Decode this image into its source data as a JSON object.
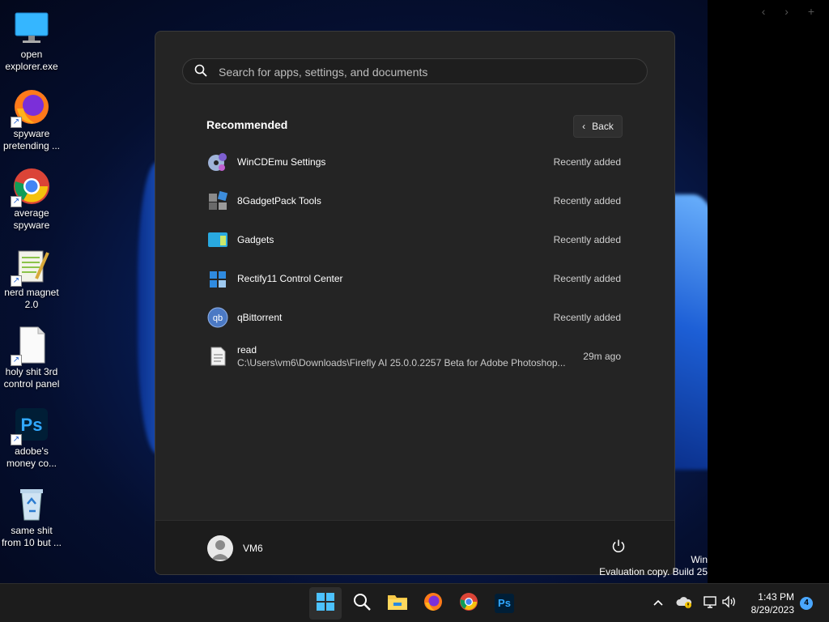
{
  "desktop": {
    "icons": [
      {
        "label": "open explorer.exe",
        "icon": "monitor-icon"
      },
      {
        "label": "spyware pretending ...",
        "icon": "firefox-icon"
      },
      {
        "label": "average spyware",
        "icon": "chrome-icon"
      },
      {
        "label": "nerd magnet 2.0",
        "icon": "notepad-plus-plus-icon"
      },
      {
        "label": "holy shit 3rd control panel",
        "icon": "blank-file-icon"
      },
      {
        "label": "adobe's money co...",
        "icon": "photoshop-icon"
      },
      {
        "label": "same shit from 10 but ...",
        "icon": "recycle-bin-icon"
      }
    ],
    "watermark_line1": "Win",
    "watermark_line2": "Evaluation copy. Build 25"
  },
  "start_menu": {
    "search": {
      "placeholder": "Search for apps, settings, and documents",
      "value": ""
    },
    "recommended_title": "Recommended",
    "back_label": "Back",
    "items": [
      {
        "name": "WinCDEmu Settings",
        "time": "Recently added",
        "icon": "wincdemu-icon"
      },
      {
        "name": "8GadgetPack Tools",
        "time": "Recently added",
        "icon": "gadgetpack-icon"
      },
      {
        "name": "Gadgets",
        "time": "Recently added",
        "icon": "gadgets-icon"
      },
      {
        "name": "Rectify11 Control Center",
        "time": "Recently added",
        "icon": "rectify11-icon"
      },
      {
        "name": "qBittorrent",
        "time": "Recently added",
        "icon": "qbittorrent-icon"
      },
      {
        "name": "read",
        "path": "C:\\Users\\vm6\\Downloads\\Firefly AI 25.0.0.2257 Beta for Adobe Photoshop...",
        "time": "29m ago",
        "icon": "text-file-icon"
      }
    ],
    "user_name": "VM6"
  },
  "taskbar": {
    "apps": [
      "start-icon",
      "search-icon",
      "file-explorer-icon",
      "firefox-icon",
      "chrome-icon",
      "photoshop-icon"
    ],
    "photoshop_label": "Ps",
    "time": "1:43 PM",
    "date": "8/29/2023",
    "notification_count": "4"
  },
  "colors": {
    "accent": "#4aa7ff",
    "start_bg": "#242424",
    "taskbar_bg": "#1c1c1c"
  }
}
